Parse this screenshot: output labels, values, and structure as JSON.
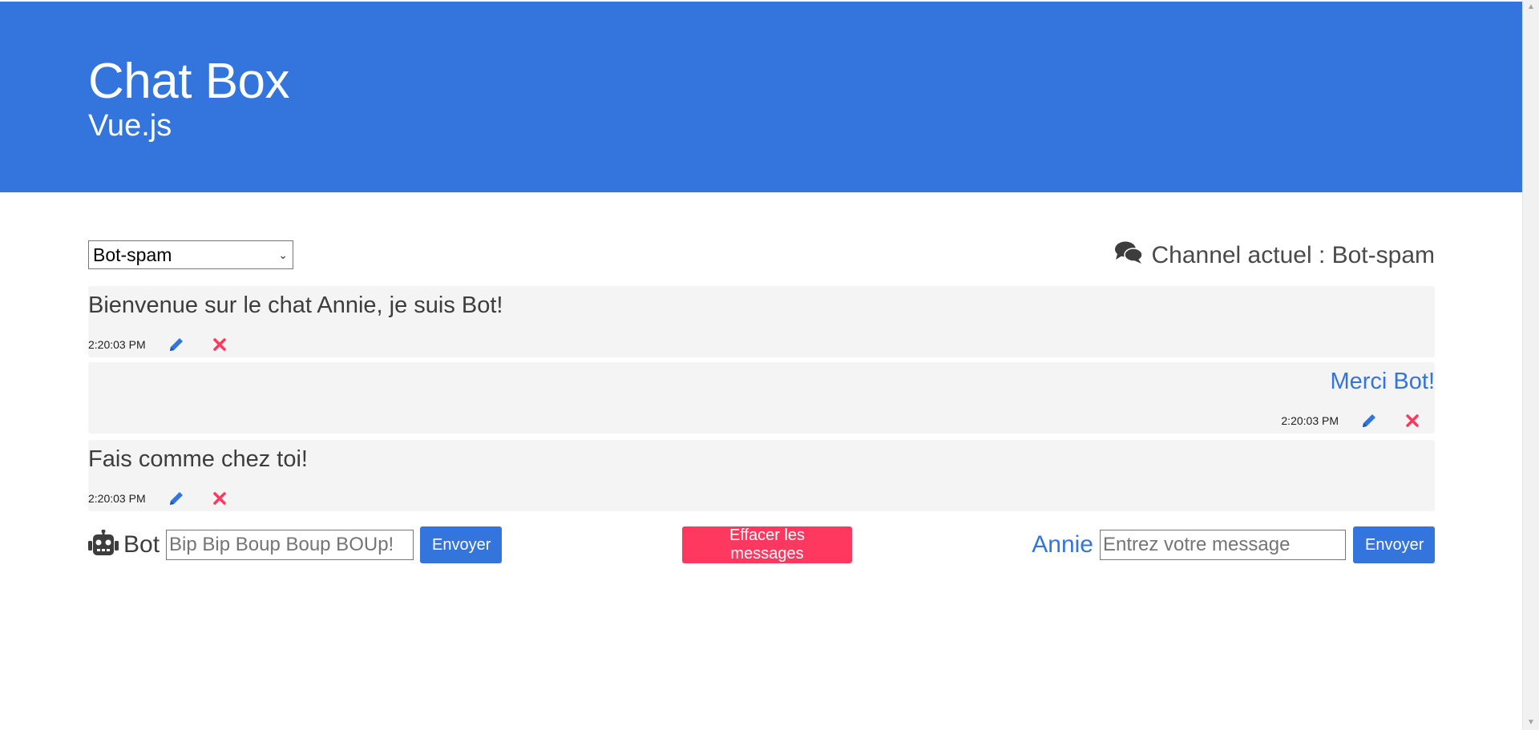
{
  "header": {
    "title": "Chat Box",
    "subtitle": "Vue.js"
  },
  "channel": {
    "selected": "Bot-spam",
    "info_label": "Channel actuel : Bot-spam",
    "icon": "comments-icon"
  },
  "messages": [
    {
      "text": "Bienvenue sur le chat Annie, je suis Bot!",
      "time": "2:20:03 PM",
      "author": "Bot",
      "side": "left"
    },
    {
      "text": "Merci Bot!",
      "time": "2:20:03 PM",
      "author": "Annie",
      "side": "right"
    },
    {
      "text": "Fais comme chez toi!",
      "time": "2:20:03 PM",
      "author": "Bot",
      "side": "left"
    }
  ],
  "composer": {
    "bot_label": "Bot",
    "bot_placeholder": "Bip Bip Boup Boup BOUp!",
    "bot_send_label": "Envoyer",
    "clear_label": "Effacer les messages",
    "annie_label": "Annie",
    "annie_placeholder": "Entrez votre message",
    "annie_send_label": "Envoyer"
  },
  "colors": {
    "primary": "#3374dd",
    "danger": "#ff3860",
    "message_bg": "#f4f4f4"
  }
}
